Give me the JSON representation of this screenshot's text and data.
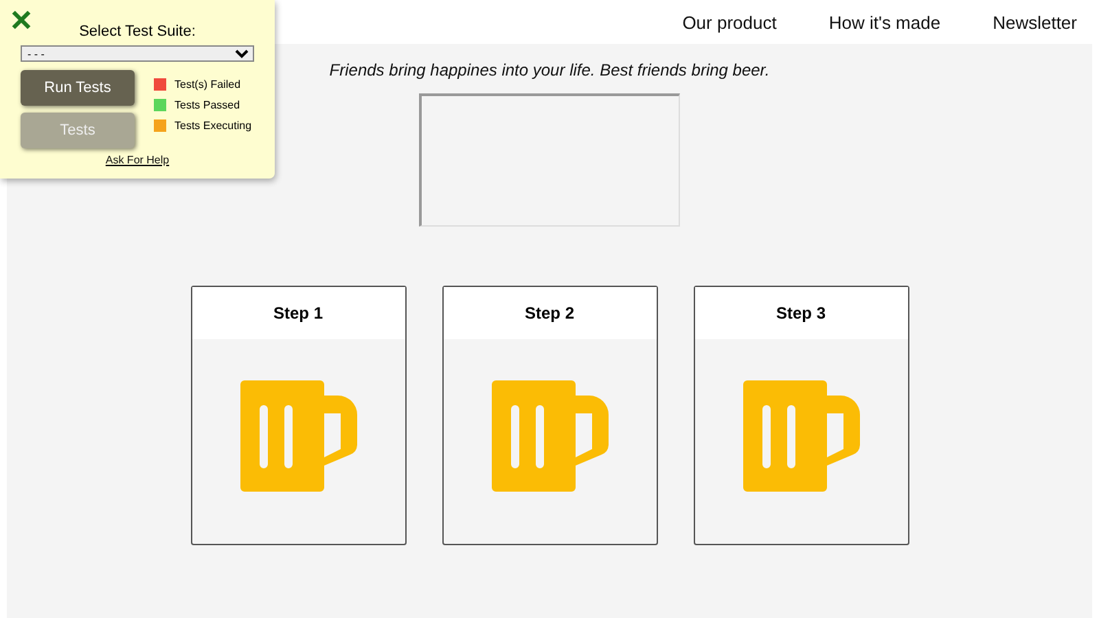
{
  "nav": {
    "items": [
      "Our product",
      "How it's made",
      "Newsletter"
    ]
  },
  "quote": "Friends bring happines into your life. Best friends bring beer.",
  "steps": [
    {
      "title": "Step 1"
    },
    {
      "title": "Step 2"
    },
    {
      "title": "Step 3"
    }
  ],
  "test_panel": {
    "title": "Select Test Suite:",
    "suite_value": "- - -",
    "buttons": [
      {
        "label": "Run Tests",
        "disabled": false
      },
      {
        "label": "Tests",
        "disabled": true
      }
    ],
    "legend": [
      {
        "label": "Test(s) Failed",
        "color": "#f04a3c"
      },
      {
        "label": "Tests Passed",
        "color": "#5cd65c"
      },
      {
        "label": "Tests Executing",
        "color": "#f5a31c"
      }
    ],
    "help_link": "Ask For Help"
  }
}
